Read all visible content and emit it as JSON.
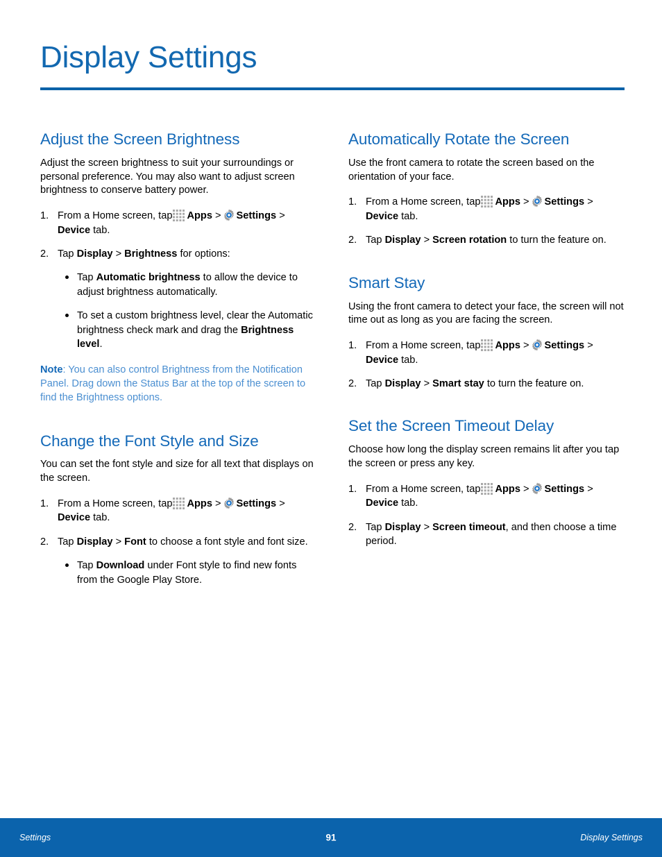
{
  "page_title": "Display Settings",
  "colors": {
    "title_blue": "#1268b0",
    "heading_blue": "#1469b8",
    "rule_blue": "#0b62a8",
    "note_blue": "#4b8fd1",
    "footer_blue": "#0b63ac"
  },
  "icons": {
    "apps": "apps-grid-icon",
    "settings": "gear-icon"
  },
  "left_column": {
    "brightness": {
      "heading": "Adjust the Screen Brightness",
      "intro": "Adjust the screen brightness to suit your surroundings or personal preference. You may also want to adjust screen brightness to conserve battery power.",
      "step1": {
        "num": "1.",
        "text_a": "From a Home screen, tap",
        "apps_label": "Apps",
        "sep": ">",
        "settings_label": "Settings",
        "text_b": ">",
        "device_label": "Device",
        "text_c": "tab."
      },
      "step2": {
        "num": "2.",
        "text_a": "Tap",
        "bold_a": "Display",
        "sep": ">",
        "bold_b": "Brightness",
        "text_b": "for options:"
      },
      "bullet1": {
        "text_a": "Tap",
        "bold_a": "Automatic brightness",
        "text_b": "to allow the device to adjust brightness automatically."
      },
      "bullet2": {
        "text_a": "To set a custom brightness level, clear the Automatic brightness check mark and drag the",
        "bold_a": "Brightness level",
        "text_b": "."
      },
      "note": {
        "label": "Note",
        "text": ": You can also control Brightness from the Notification Panel. Drag down the Status Bar at the top of the screen to find the Brightness options."
      }
    },
    "font": {
      "heading": "Change the Font Style and Size",
      "intro": "You can set the font style and size for all text that displays on the screen.",
      "step1": {
        "num": "1.",
        "text_a": "From a Home screen, tap",
        "apps_label": "Apps",
        "sep": ">",
        "settings_label": "Settings",
        "text_b": ">",
        "device_label": "Device",
        "text_c": "tab."
      },
      "step2": {
        "num": "2.",
        "text_a": "Tap",
        "bold_a": "Display",
        "sep": ">",
        "bold_b": "Font",
        "text_b": "to choose a font style and font size."
      },
      "bullet1": {
        "text_a": "Tap",
        "bold_a": "Download",
        "text_b": "under Font style to find new fonts from the Google Play Store."
      }
    }
  },
  "right_column": {
    "rotate": {
      "heading": "Automatically Rotate the Screen",
      "intro": "Use the front camera to rotate the screen based on the orientation of your face.",
      "step1": {
        "num": "1.",
        "text_a": "From a Home screen, tap",
        "apps_label": "Apps",
        "sep": ">",
        "settings_label": "Settings",
        "text_b": ">",
        "device_label": "Device",
        "text_c": "tab."
      },
      "step2": {
        "num": "2.",
        "text_a": "Tap",
        "bold_a": "Display",
        "sep": ">",
        "bold_b": "Screen rotation",
        "text_b": "to turn the feature on."
      }
    },
    "smart_stay": {
      "heading": "Smart Stay",
      "intro": "Using the front camera to detect your face, the screen will not time out as long as you are facing the screen.",
      "step1": {
        "num": "1.",
        "text_a": "From a Home screen, tap",
        "apps_label": "Apps",
        "sep": ">",
        "settings_label": "Settings",
        "text_b": ">",
        "device_label": "Device",
        "text_c": "tab."
      },
      "step2": {
        "num": "2.",
        "text_a": "Tap",
        "bold_a": "Display",
        "sep": ">",
        "bold_b": "Smart stay",
        "text_b": "to turn the feature on."
      }
    },
    "timeout": {
      "heading": "Set the Screen Timeout Delay",
      "intro": "Choose how long the display screen remains lit after you tap the screen or press any key.",
      "step1": {
        "num": "1.",
        "text_a": "From a Home screen, tap",
        "apps_label": "Apps",
        "sep": ">",
        "settings_label": "Settings",
        "text_b": ">",
        "device_label": "Device",
        "text_c": "tab."
      },
      "step2": {
        "num": "2.",
        "text_a": "Tap",
        "bold_a": "Display",
        "sep": ">",
        "bold_b": "Screen timeout",
        "text_b": ", and then choose a time period."
      }
    }
  },
  "footer": {
    "left": "Settings",
    "page_number": "91",
    "right": "Display Settings"
  }
}
